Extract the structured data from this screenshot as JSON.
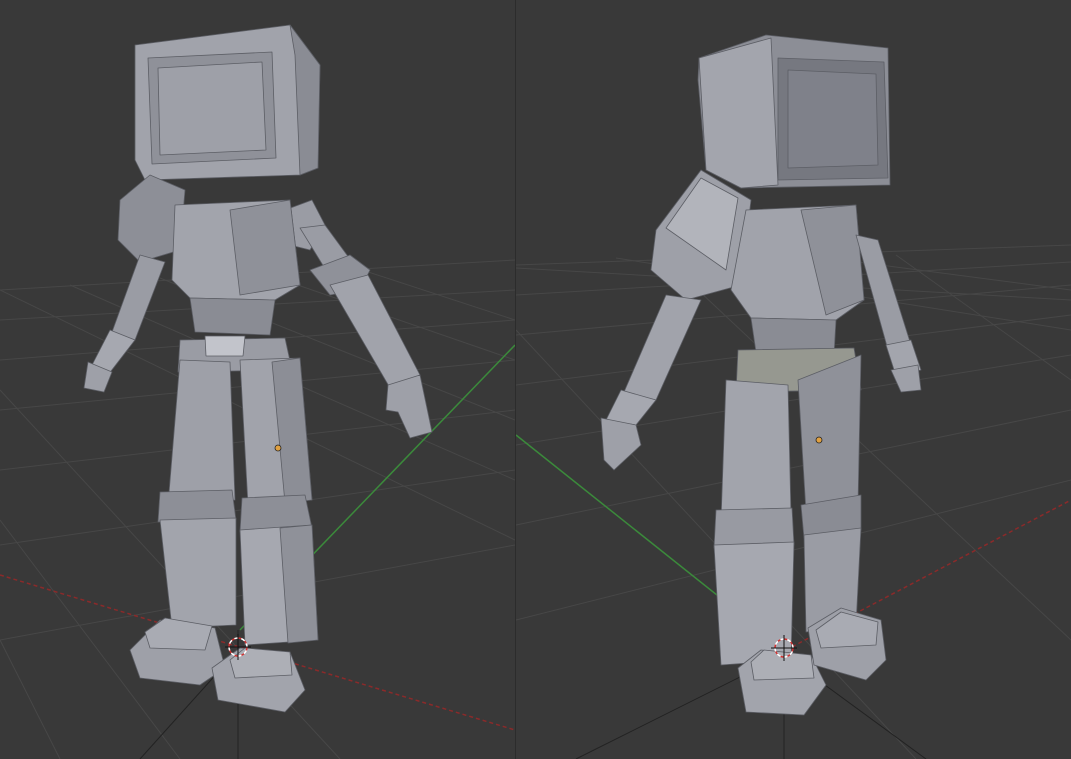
{
  "viewports": [
    {
      "name": "left",
      "object": "robot-model",
      "view": "front-left",
      "shading": "solid"
    },
    {
      "name": "right",
      "object": "robot-model",
      "view": "front-right",
      "shading": "solid"
    }
  ],
  "colors": {
    "background": "#393939",
    "grid": "#474747",
    "x_axis": "#8b2a2a",
    "y_axis": "#3b8a3b",
    "mesh_light": "#a6a8b0",
    "mesh_mid": "#8f9199",
    "mesh_dark": "#6d6f77",
    "origin_point": "#e0a040",
    "cursor_red": "#d03030",
    "cursor_white": "#ffffff"
  },
  "icons": [
    "3d-cursor-icon",
    "object-origin-icon"
  ]
}
